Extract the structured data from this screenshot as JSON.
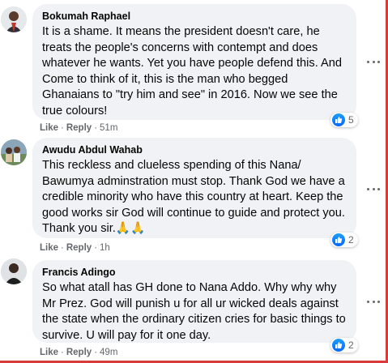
{
  "comments": [
    {
      "author": "Bokumah Raphael",
      "text": "It is a shame. It means the president doesn't care, he treats the people's concerns with contempt and does whatever he wants. Yet you have people defend this. And Come to think of it, this is the man who begged Ghanaians to \"try him and see\" in 2016. Now we see the true colours!",
      "like_label": "Like",
      "reply_label": "Reply",
      "time": "51m",
      "reaction_count": "5"
    },
    {
      "author": "Awudu Abdul Wahab",
      "text": "This reckless and clueless spending of this Nana/ Bawumya adminstration must stop. Thank God we have a credible minority who have this country at heart. Keep the good works sir God will continue to guide and protect you. Thank you sir.🙏🙏",
      "like_label": "Like",
      "reply_label": "Reply",
      "time": "1h",
      "reaction_count": "2"
    },
    {
      "author": "Francis Adingo",
      "text": "So what atall has GH done to Nana Addo. Why why why Mr Prez. God will punish u for all ur wicked deals against the state when the ordinary citizen cries for basic things to survive. U will pay for it one day.",
      "like_label": "Like",
      "reply_label": "Reply",
      "time": "49m",
      "reaction_count": "2"
    }
  ],
  "icons": {
    "reaction": "like-icon",
    "menu": "more-options-icon"
  },
  "colors": {
    "bubble": "#f0f2f5",
    "meta": "#65676b",
    "like": "#0866ff"
  }
}
